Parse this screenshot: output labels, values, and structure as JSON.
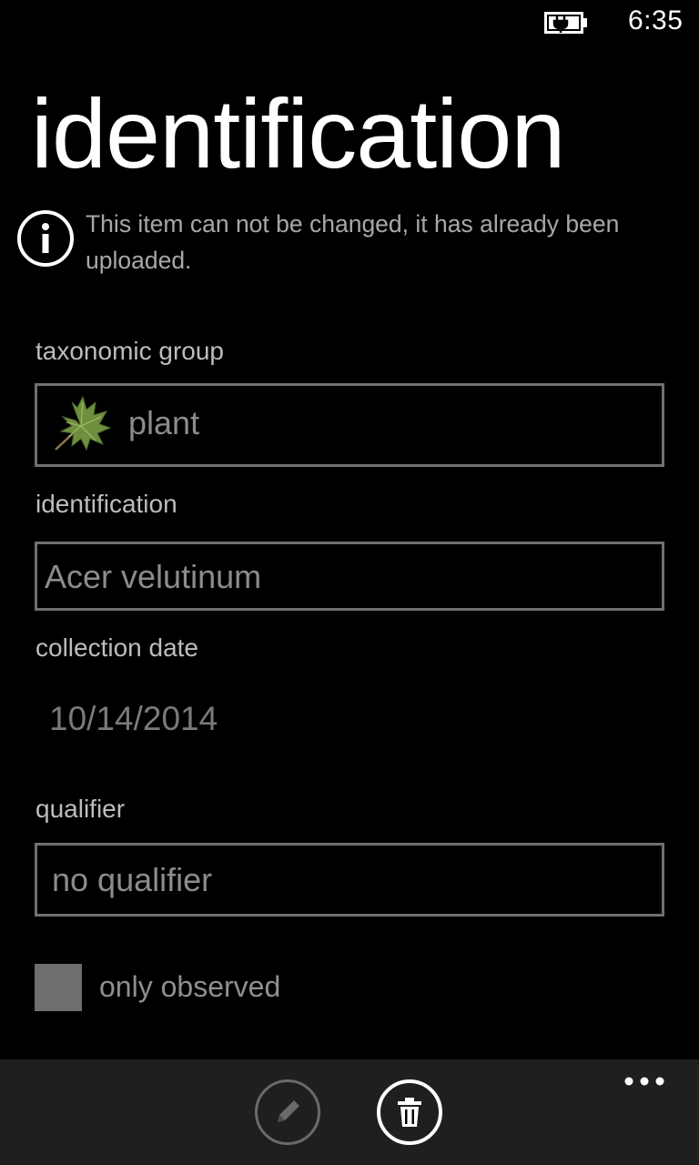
{
  "status_bar": {
    "time": "6:35",
    "battery_icon": "battery-charging-icon"
  },
  "page": {
    "title": "identification"
  },
  "notice": {
    "icon": "info-icon",
    "text": "This item can not be changed, it has already been uploaded."
  },
  "form": {
    "taxonomic_group": {
      "label": "taxonomic group",
      "value": "plant",
      "icon": "leaf-icon"
    },
    "identification": {
      "label": "identification",
      "value": "Acer velutinum"
    },
    "collection_date": {
      "label": "collection date",
      "value": "10/14/2014"
    },
    "qualifier": {
      "label": "qualifier",
      "value": "no qualifier"
    },
    "only_observed": {
      "label": "only observed",
      "checked": false
    }
  },
  "app_bar": {
    "buttons": [
      {
        "icon": "pencil-icon",
        "enabled": false
      },
      {
        "icon": "trash-icon",
        "enabled": true
      }
    ],
    "more_icon": "ellipsis-icon"
  },
  "colors": {
    "background": "#000000",
    "app_bar": "#1f1f1f",
    "field_border": "#707070",
    "disabled_text": "#8c8c8c"
  }
}
